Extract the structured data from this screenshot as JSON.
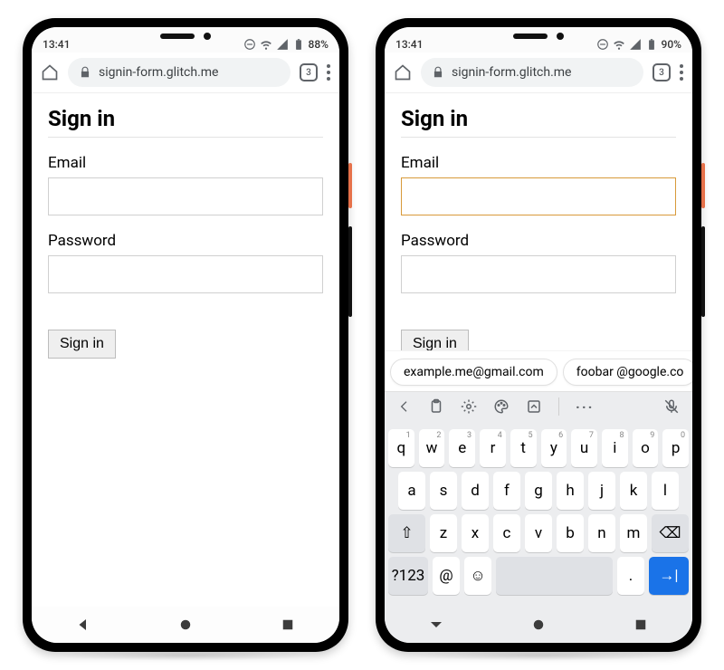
{
  "left": {
    "status": {
      "time": "13:41",
      "battery": "88%"
    },
    "url": "signin-form.glitch.me",
    "tab_count": "3",
    "page": {
      "title": "Sign in",
      "email_label": "Email",
      "email_value": "",
      "password_label": "Password",
      "password_value": "",
      "submit": "Sign in"
    }
  },
  "right": {
    "status": {
      "time": "13:41",
      "battery": "90%"
    },
    "url": "signin-form.glitch.me",
    "tab_count": "3",
    "page": {
      "title": "Sign in",
      "email_label": "Email",
      "email_value": "",
      "password_label": "Password",
      "password_value": "",
      "submit": "Sign in"
    },
    "suggestions": [
      "example.me@gmail.com",
      "foobar @google.co"
    ],
    "keyboard": {
      "row1": [
        "q",
        "w",
        "e",
        "r",
        "t",
        "y",
        "u",
        "i",
        "o",
        "p"
      ],
      "row1_sup": [
        "1",
        "2",
        "3",
        "4",
        "5",
        "6",
        "7",
        "8",
        "9",
        "0"
      ],
      "row2": [
        "a",
        "s",
        "d",
        "f",
        "g",
        "h",
        "j",
        "k",
        "l"
      ],
      "row3": [
        "z",
        "x",
        "c",
        "v",
        "b",
        "n",
        "m"
      ],
      "sym": "?123",
      "at": "@",
      "dot": "."
    }
  }
}
